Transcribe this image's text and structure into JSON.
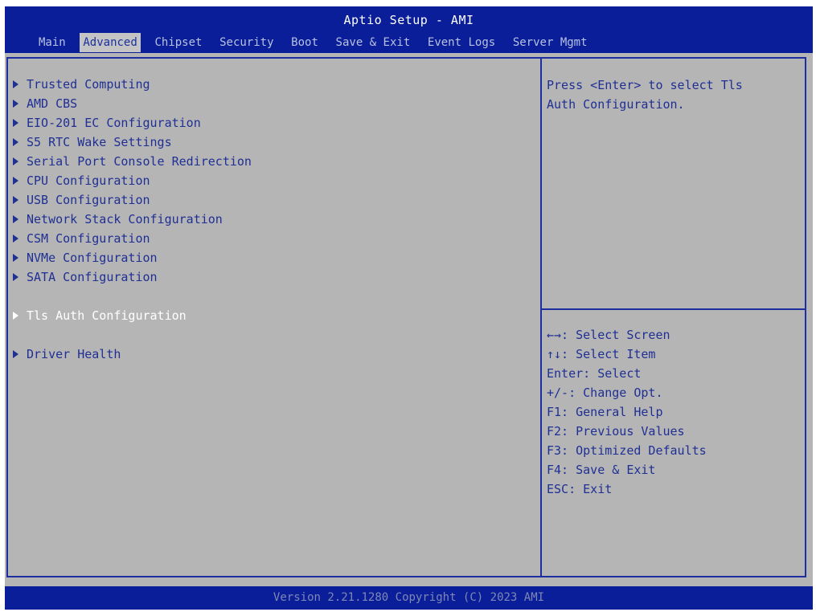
{
  "header": {
    "title": "Aptio Setup - AMI",
    "tabs": [
      {
        "label": "Main",
        "active": false
      },
      {
        "label": "Advanced",
        "active": true
      },
      {
        "label": "Chipset",
        "active": false
      },
      {
        "label": "Security",
        "active": false
      },
      {
        "label": "Boot",
        "active": false
      },
      {
        "label": "Save & Exit",
        "active": false
      },
      {
        "label": "Event Logs",
        "active": false
      },
      {
        "label": "Server Mgmt",
        "active": false
      }
    ]
  },
  "menu": {
    "items": [
      {
        "label": "Trusted Computing",
        "selected": false
      },
      {
        "label": "AMD CBS",
        "selected": false
      },
      {
        "label": "EIO-201 EC Configuration",
        "selected": false
      },
      {
        "label": "S5 RTC Wake Settings",
        "selected": false
      },
      {
        "label": "Serial Port Console Redirection",
        "selected": false
      },
      {
        "label": "CPU Configuration",
        "selected": false
      },
      {
        "label": "USB Configuration",
        "selected": false
      },
      {
        "label": "Network Stack Configuration",
        "selected": false
      },
      {
        "label": "CSM Configuration",
        "selected": false
      },
      {
        "label": "NVMe Configuration",
        "selected": false
      },
      {
        "label": "SATA Configuration",
        "selected": false
      },
      {
        "label": "Tls Auth Configuration",
        "selected": true
      },
      {
        "label": "Driver Health",
        "selected": false
      }
    ]
  },
  "help": {
    "text": "Press <Enter> to select Tls\nAuth Configuration."
  },
  "keys": [
    "←→: Select Screen",
    "↑↓: Select Item",
    "Enter: Select",
    "+/-: Change Opt.",
    "F1: General Help",
    "F2: Previous Values",
    "F3: Optimized Defaults",
    "F4: Save & Exit",
    "ESC: Exit"
  ],
  "footer": {
    "text": "Version 2.21.1280 Copyright (C) 2023 AMI"
  },
  "colors": {
    "frame_blue": "#0a1e9a",
    "panel_gray": "#b5b5b5",
    "text_blue": "#1f2f94",
    "selected_text": "#ffffff"
  }
}
